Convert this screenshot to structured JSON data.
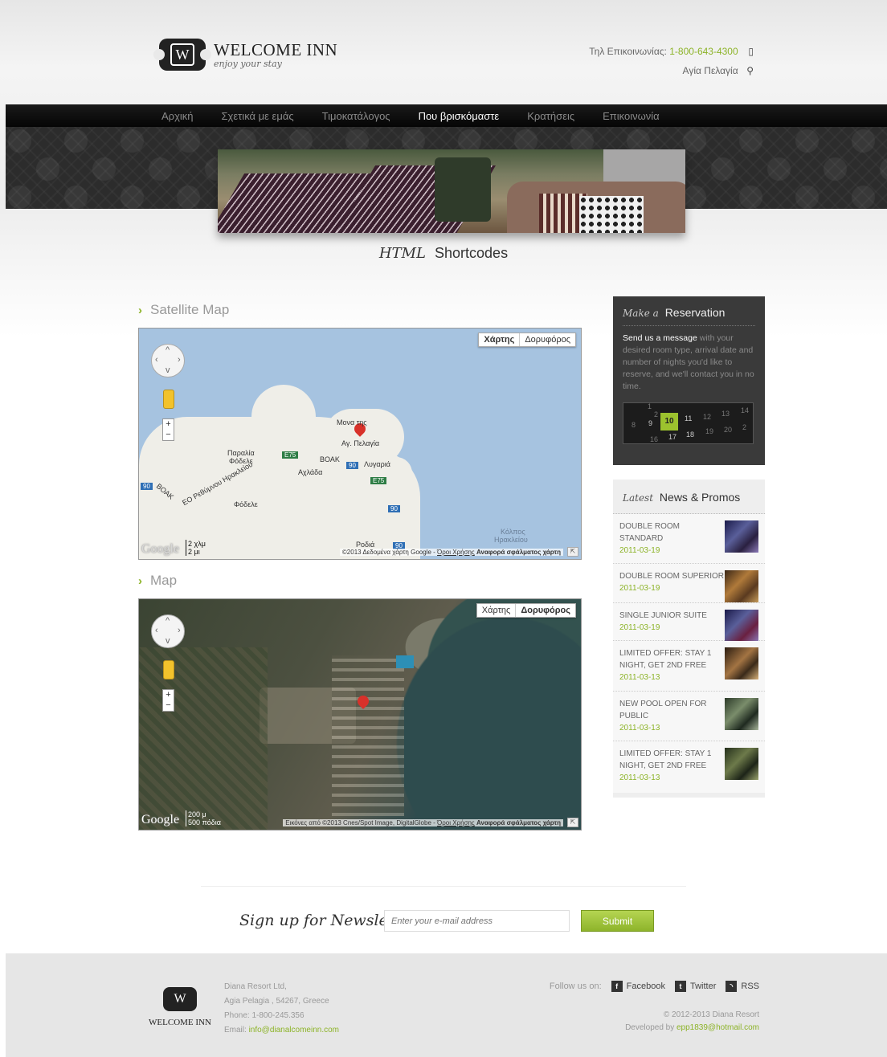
{
  "header": {
    "logo_title": "WELCOME INN",
    "logo_tagline": "enjoy your stay",
    "logo_letter": "W",
    "phone_label": "Τηλ Επικοινωνίας:",
    "phone_number": "1-800-643-4300",
    "location": "Αγία Πελαγία",
    "phone_icon": "phone-icon",
    "location_icon": "map-pin-icon"
  },
  "nav": {
    "items": [
      {
        "label": "Αρχική",
        "active": false
      },
      {
        "label": "Σχετικά με εμάς",
        "active": false
      },
      {
        "label": "Τιμοκατάλογος",
        "active": false
      },
      {
        "label": "Που βρισκόμαστε",
        "active": true
      },
      {
        "label": "Κρατήσεις",
        "active": false
      },
      {
        "label": "Επικοινωνία",
        "active": false
      }
    ]
  },
  "page": {
    "title_script": "HTML",
    "title_rest": "Shortcodes"
  },
  "main": {
    "satellite_section_title": "Satellite Map",
    "map_section_title": "Map",
    "map_type_map": "Χάρτης",
    "map_type_sat": "Δορυφόρος",
    "roadmap": {
      "labels": {
        "monastery": "Μονα    της",
        "agpel": "Αγ. Πελαγία",
        "paralia": "Παραλία",
        "fodele_small": "Φόδελε",
        "achlada": "Αχλάδα",
        "lygaria": "Λυγαριά",
        "voak_road": "ΒΟΑΚ",
        "eo_road": "ΕΟ Ρεθύμνου Ηρακλείου",
        "voak_left": "ΒΟΑΚ",
        "fodele": "Φόδελε",
        "rodia": "Ροδιά",
        "kolpos": "Κόλπος",
        "irakleiou": "Ηρακλείου"
      },
      "shields": {
        "e75a": "E75",
        "e75b": "E75",
        "r90a": "90",
        "r90b": "90",
        "r90c": "90",
        "r90d": "90",
        "r90e": "90"
      },
      "scale_top": "2 χλμ",
      "scale_bottom": "2 μι",
      "attribution": "©2013 Δεδομένα χάρτη Google -",
      "terms": "Όροι Χρήσης",
      "report": "Αναφορά σφάλματος χάρτη"
    },
    "satellite": {
      "scale_top": "200 μ",
      "scale_bottom": "500 πόδια",
      "attribution": "Εικόνες από ©2013 Cnes/Spot Image, DigitalGlobe -",
      "terms": "Όροι Χρήσης",
      "report": "Αναφορά σφάλματος χάρτη"
    },
    "google_label": "Google",
    "zoom_in": "+",
    "zoom_out": "−"
  },
  "sidebar": {
    "reservation": {
      "title_script": "Make a",
      "title_rest": "Reservation",
      "text_highlight": "Send us a message",
      "text_rest": " with your desired room type, arrival date and number of nights you'd like to reserve, and we'll contact you in no time.",
      "calendar": {
        "top": [
          "1",
          "2"
        ],
        "row1": [
          "8",
          "9",
          "10",
          "11",
          "12",
          "13",
          "14"
        ],
        "row2": [
          "16",
          "17",
          "18",
          "19",
          "20",
          "2"
        ]
      }
    },
    "news": {
      "title_script": "Latest",
      "title_rest": "News & Promos",
      "items": [
        {
          "title": "DOUBLE ROOM STANDARD",
          "date": "2011-03-19"
        },
        {
          "title": "DOUBLE ROOM SUPERIOR",
          "date": "2011-03-19"
        },
        {
          "title": "SINGLE JUNIOR SUITE",
          "date": "2011-03-19"
        },
        {
          "title": "LIMITED OFFER: STAY 1 NIGHT, GET 2ND FREE",
          "date": "2011-03-13"
        },
        {
          "title": "NEW POOL OPEN FOR PUBLIC",
          "date": "2011-03-13"
        },
        {
          "title": "LIMITED OFFER: STAY 1 NIGHT, GET 2ND FREE",
          "date": "2011-03-13"
        }
      ]
    }
  },
  "newsletter": {
    "label": "Sign up for Newsletter",
    "placeholder": "Enter your e-mail address",
    "submit": "Submit"
  },
  "footer": {
    "brand": "WELCOME INN",
    "logo_letter": "W",
    "company": "Diana Resort Ltd,",
    "address": "Agia Pelagia , 54267, Greece",
    "phone": "Phone: 1-800-245.356",
    "email_label": "Email: ",
    "email": "info@dianalcomeinn.com",
    "follow": "Follow us on:",
    "facebook": "Facebook",
    "twitter": "Twitter",
    "rss": "RSS",
    "copyright": "© 2012-2013 Diana Resort",
    "developed_label": "Developed by ",
    "developer_email": "epp1839@hotmail.com"
  }
}
